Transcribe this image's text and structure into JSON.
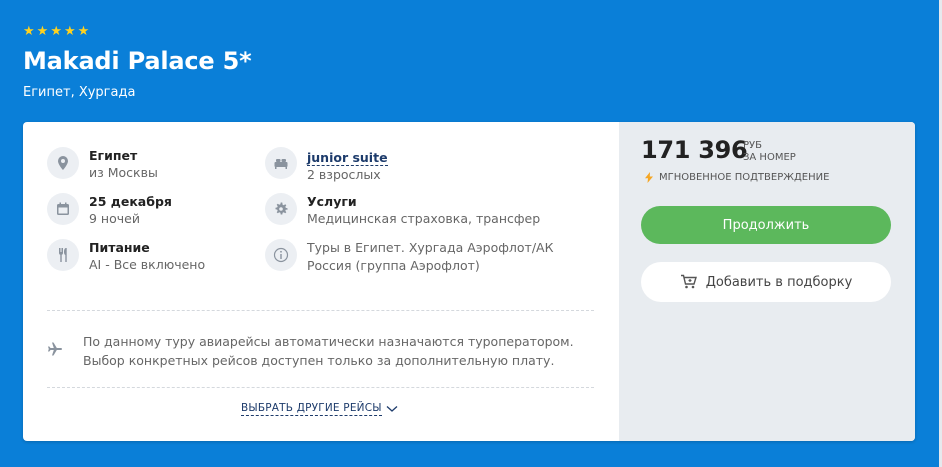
{
  "hotel": {
    "stars_count": 5,
    "name": "Makadi Palace 5*",
    "location": "Египет, Хургада"
  },
  "details": {
    "destination_title": "Египет",
    "destination_sub": "из Москвы",
    "date_title": "25 декабря",
    "date_sub": "9 ночей",
    "meal_title": "Питание",
    "meal_sub": "AI - Все включено",
    "room_title": "junior suite",
    "room_sub": "2 взрослых",
    "services_title": "Услуги",
    "services_sub": "Медицинская страховка, трансфер",
    "tour_line1": "Туры в Египет. Хургада Аэрофлот/АК",
    "tour_line2": "Россия (группа Аэрофлот)"
  },
  "flights": {
    "note_line1": "По данному туру авиарейсы автоматически назначаются туроператором.",
    "note_line2": "Выбор конкретных рейсов доступен только за дополнительную плату.",
    "more_link": "ВЫБРАТЬ ДРУГИЕ РЕЙСЫ"
  },
  "pricing": {
    "price": "171 396",
    "currency": "РУБ",
    "per": "ЗА НОМЕР",
    "instant": "МГНОВЕННОЕ ПОДТВЕРЖДЕНИЕ",
    "continue_label": "Продолжить",
    "add_label": "Добавить в подборку"
  },
  "colors": {
    "background": "#0a7fd8",
    "accent_green": "#5cb85c",
    "star": "#ffd21f",
    "lightning": "#f5a623"
  }
}
